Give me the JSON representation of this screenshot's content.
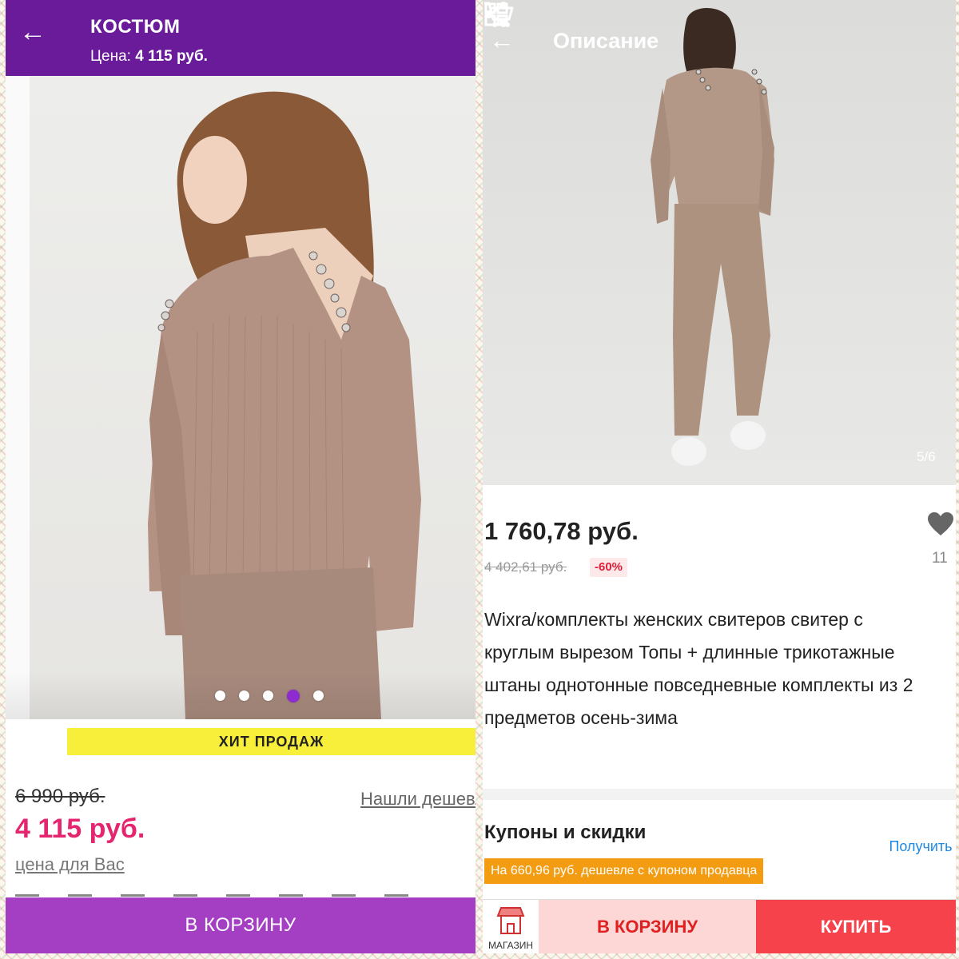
{
  "left": {
    "header": {
      "title": "КОСТЮМ",
      "price_label": "Цена:",
      "price_value": "4 115 руб."
    },
    "gallery": {
      "dot_count": 5,
      "active_index": 3
    },
    "badge": "ХИТ ПРОДАЖ",
    "old_price": "6 990 руб.",
    "found_cheaper": "Нашли дешевле?",
    "new_price": "4 115 руб.",
    "price_for_you": "цена для Вас",
    "add_to_cart": "В КОРЗИНУ",
    "colors": {
      "header": "#6a1b9a",
      "price": "#e5256f",
      "cart_button": "#a43fc4",
      "badge": "#f8ef3a"
    }
  },
  "right": {
    "header": {
      "title": "Описание"
    },
    "gallery": {
      "counter": "5/6"
    },
    "price": "1 760,78 руб.",
    "old_price": "4 402,61 руб.",
    "discount": "-60%",
    "likes": "11",
    "description": "Wixra/комплекты женских свитеров свитер с круглым вырезом Топы + длинные трикотажные штаны однотонные повседневные комплекты из 2 предметов осень-зима",
    "coupons_title": "Купоны и скидки",
    "coupon_tag": "На 660,96 руб. дешевле с купоном продавца",
    "get_coupon": "Получить",
    "shop_label": "МАГАЗИН",
    "add_to_cart": "В КОРЗИНУ",
    "buy": "КУПИТЬ",
    "colors": {
      "buy_button": "#f5424b",
      "cart_button_bg": "#fdd6d6",
      "coupon_tag": "#f39c12",
      "link": "#1e88e5"
    }
  }
}
